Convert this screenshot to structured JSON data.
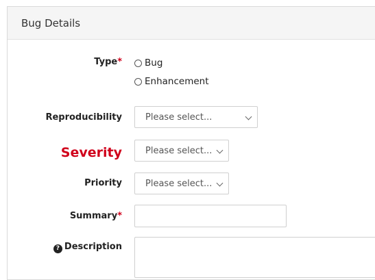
{
  "panel": {
    "title": "Bug Details"
  },
  "fields": {
    "type": {
      "label": "Type",
      "required_mark": "*",
      "options": [
        "Bug",
        "Enhancement"
      ]
    },
    "reproducibility": {
      "label": "Reproducibility",
      "value": "Please select..."
    },
    "severity": {
      "label": "Severity",
      "value": "Please select..."
    },
    "priority": {
      "label": "Priority",
      "value": "Please select..."
    },
    "summary": {
      "label": "Summary",
      "required_mark": "*",
      "value": ""
    },
    "description": {
      "label": "Description",
      "help_icon_glyph": "?",
      "value": ""
    }
  },
  "colors": {
    "required": "#d0011b",
    "severity_label": "#d0011b",
    "header_bg": "#f5f5f5"
  },
  "icons": {
    "description_help": "question-circle-icon",
    "select_chevron": "chevron-down-icon"
  }
}
